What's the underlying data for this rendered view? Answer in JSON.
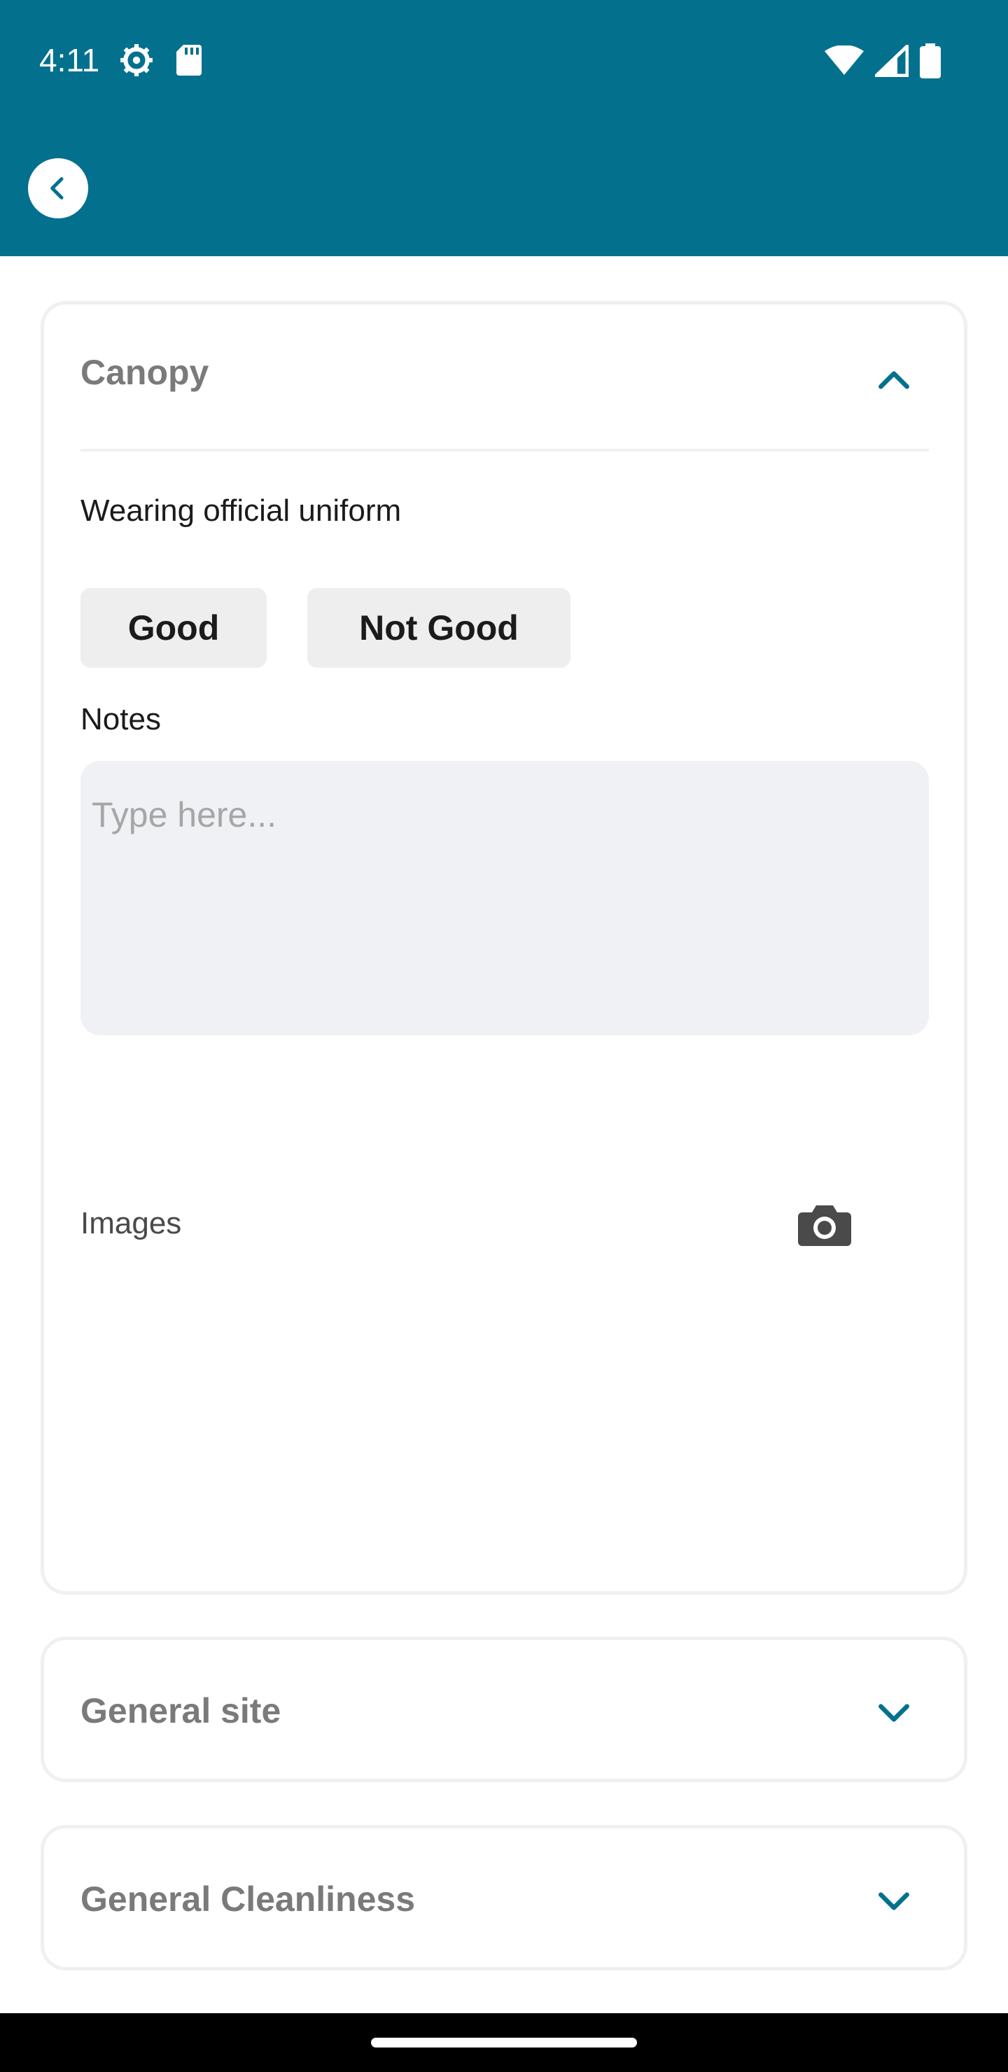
{
  "status_bar": {
    "time": "4:11"
  },
  "colors": {
    "header": "#03718d",
    "accent": "#03718d",
    "card_title": "#7a7a7a"
  },
  "sections": {
    "canopy": {
      "title": "Canopy",
      "expanded": true,
      "question": "Wearing official uniform",
      "options": [
        "Good",
        "Not Good"
      ],
      "notes_label": "Notes",
      "notes_placeholder": "Type here...",
      "notes_value": "",
      "images_label": "Images"
    },
    "general_site": {
      "title": "General site",
      "expanded": false
    },
    "general_cleanliness": {
      "title": "General Cleanliness",
      "expanded": false
    }
  },
  "icons": {
    "back": "chevron-left-icon",
    "collapse": "chevron-up-icon",
    "expand": "chevron-down-icon",
    "camera": "camera-icon"
  }
}
